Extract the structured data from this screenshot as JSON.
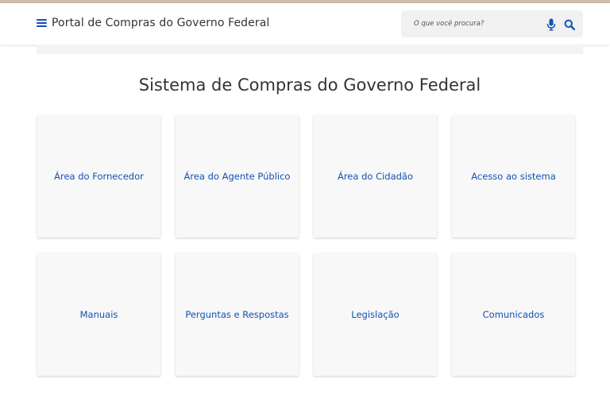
{
  "header": {
    "site_title": "Portal de Compras do Governo Federal",
    "search_placeholder": "O que você procura?"
  },
  "main": {
    "title": "Sistema de Compras do Governo Federal",
    "cards": [
      {
        "label": "Área do Fornecedor"
      },
      {
        "label": "Área do Agente Público"
      },
      {
        "label": "Área do Cidadão"
      },
      {
        "label": "Acesso ao sistema"
      },
      {
        "label": "Manuais"
      },
      {
        "label": "Perguntas e Respostas"
      },
      {
        "label": "Legislação"
      },
      {
        "label": "Comunicados"
      }
    ]
  },
  "colors": {
    "accent": "#1351b4",
    "top_stripe": "#cdbfac",
    "card_bg": "#f8f8f8"
  },
  "icons": {
    "menu": "hamburger-icon",
    "mic": "microphone-icon",
    "search": "magnifier-icon"
  }
}
